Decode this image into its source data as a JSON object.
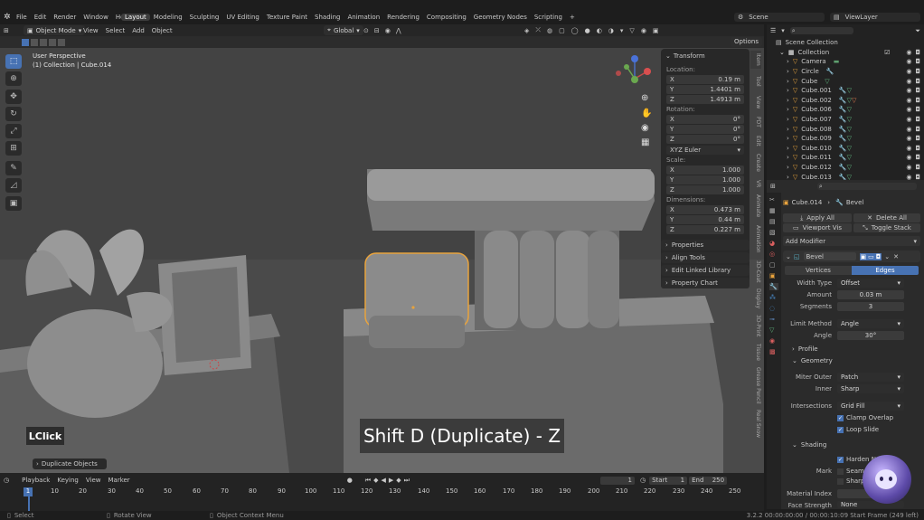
{
  "topbar": {
    "menu": [
      "File",
      "Edit",
      "Render",
      "Window",
      "Help"
    ],
    "workspaces": [
      "Layout",
      "Modeling",
      "Sculpting",
      "UV Editing",
      "Texture Paint",
      "Shading",
      "Animation",
      "Rendering",
      "Compositing",
      "Geometry Nodes",
      "Scripting"
    ],
    "active_workspace": "Layout",
    "scene": "Scene",
    "view_layer": "ViewLayer"
  },
  "viewport_header": {
    "mode": "Object Mode",
    "menus": [
      "View",
      "Select",
      "Add",
      "Object"
    ],
    "orientation": "Global",
    "options": "Options"
  },
  "viewport": {
    "perspective": "User Perspective",
    "collection_info": "(1) Collection | Cube.014",
    "click_badge": "LClick",
    "caption": "Shift D (Duplicate) - Z",
    "last_op": "Duplicate Objects"
  },
  "npanel": {
    "transform_title": "Transform",
    "location_label": "Location:",
    "location": [
      {
        "axis": "X",
        "value": "0.19 m"
      },
      {
        "axis": "Y",
        "value": "1.4401 m"
      },
      {
        "axis": "Z",
        "value": "1.4913 m"
      }
    ],
    "rotation_label": "Rotation:",
    "rotation": [
      {
        "axis": "X",
        "value": "0°"
      },
      {
        "axis": "Y",
        "value": "0°"
      },
      {
        "axis": "Z",
        "value": "0°"
      }
    ],
    "rotation_mode": "XYZ Euler",
    "scale_label": "Scale:",
    "scale": [
      {
        "axis": "X",
        "value": "1.000"
      },
      {
        "axis": "Y",
        "value": "1.000"
      },
      {
        "axis": "Z",
        "value": "1.000"
      }
    ],
    "dimensions_label": "Dimensions:",
    "dimensions": [
      {
        "axis": "X",
        "value": "0.473 m"
      },
      {
        "axis": "Y",
        "value": "0.44 m"
      },
      {
        "axis": "Z",
        "value": "0.227 m"
      }
    ],
    "subpanels": [
      "Properties",
      "Align Tools",
      "Edit Linked Library",
      "Property Chart"
    ],
    "tabs": [
      "Item",
      "Tool",
      "View",
      "PDT",
      "Edit",
      "Create",
      "VR",
      "Animate",
      "Animation",
      "3D-Coat",
      "Display",
      "3D-Print",
      "Tissue",
      "Grease Pencil",
      "Real Snow"
    ]
  },
  "outliner": {
    "title": "Scene Collection",
    "items": [
      "Collection",
      "Camera",
      "Circle",
      "Cube",
      "Cube.001",
      "Cube.002",
      "Cube.006",
      "Cube.007",
      "Cube.008",
      "Cube.009",
      "Cube.010",
      "Cube.011",
      "Cube.012",
      "Cube.013"
    ]
  },
  "properties": {
    "breadcrumb_object": "Cube.014",
    "breadcrumb_modifier": "Bevel",
    "apply_all": "Apply All",
    "delete_all": "Delete All",
    "viewport_vis": "Viewport Vis",
    "toggle_stack": "Toggle Stack",
    "add_modifier": "Add Modifier",
    "modifier_name": "Bevel",
    "vertices": "Vertices",
    "edges": "Edges",
    "width_type_label": "Width Type",
    "width_type": "Offset",
    "amount_label": "Amount",
    "amount": "0.03 m",
    "segments_label": "Segments",
    "segments": "3",
    "limit_method_label": "Limit Method",
    "limit_method": "Angle",
    "angle_label": "Angle",
    "angle": "30°",
    "profile": "Profile",
    "geometry": "Geometry",
    "miter_outer_label": "Miter Outer",
    "miter_outer": "Patch",
    "inner_label": "Inner",
    "inner": "Sharp",
    "intersections_label": "Intersections",
    "intersections": "Grid Fill",
    "clamp_overlap": "Clamp Overlap",
    "loop_slide": "Loop Slide",
    "shading": "Shading",
    "harden_normals": "Harden Norm",
    "mark_label": "Mark",
    "seam": "Seam",
    "sharp": "Sharp",
    "material_index_label": "Material Index",
    "face_strength_label": "Face Strength",
    "face_strength": "None"
  },
  "timeline": {
    "menus": [
      "Playback",
      "Keying",
      "View",
      "Marker"
    ],
    "current_frame": "1",
    "start_label": "Start",
    "start": "1",
    "end_label": "End",
    "end": "250",
    "ticks": [
      "1",
      "10",
      "20",
      "30",
      "40",
      "50",
      "60",
      "70",
      "80",
      "90",
      "100",
      "110",
      "120",
      "130",
      "140",
      "150",
      "160",
      "170",
      "180",
      "190",
      "200",
      "210",
      "220",
      "230",
      "240",
      "250"
    ]
  },
  "statusbar": {
    "select": "Select",
    "rotate_view": "Rotate View",
    "context_menu": "Object Context Menu",
    "info": "3.2.2   00:00:00:00 / 00:00:10:09  Start Frame (249 left)"
  },
  "colors": {
    "accent": "#4772b3",
    "selection_outline": "#e8a33d",
    "background": "#3d3d3d"
  }
}
